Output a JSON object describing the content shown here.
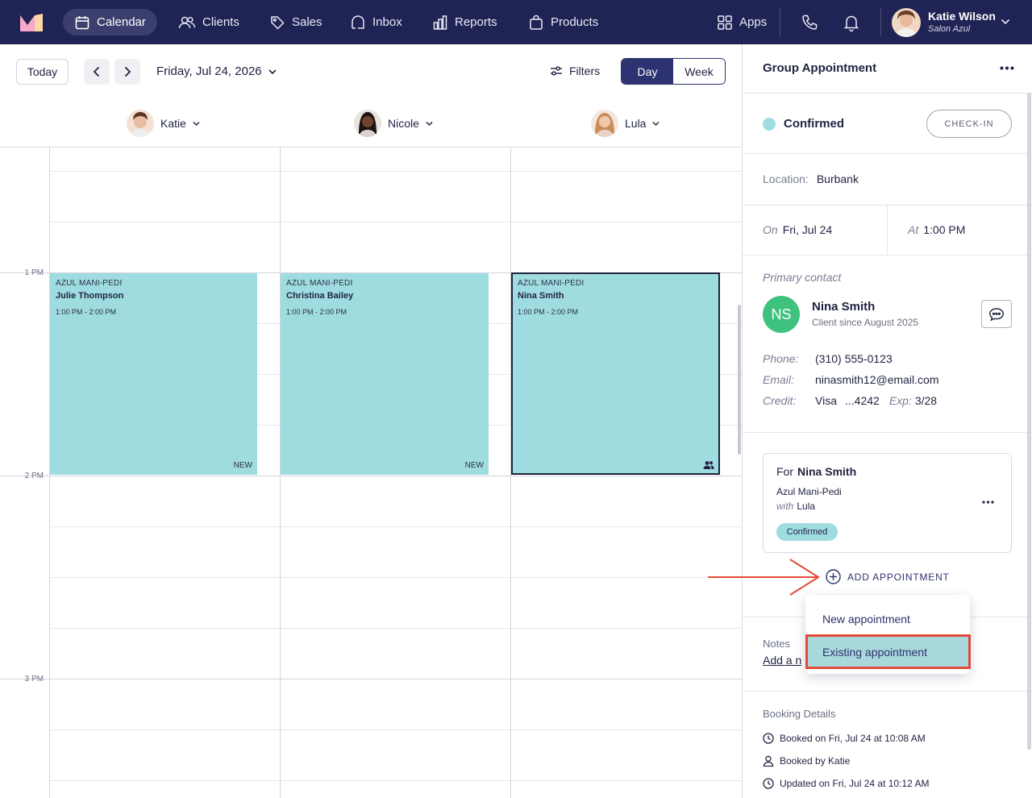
{
  "nav": {
    "items": [
      {
        "label": "Calendar",
        "icon": "calendar-icon",
        "active": true
      },
      {
        "label": "Clients",
        "icon": "clients-icon",
        "active": false
      },
      {
        "label": "Sales",
        "icon": "tag-icon",
        "active": false
      },
      {
        "label": "Inbox",
        "icon": "inbox-icon",
        "active": false
      },
      {
        "label": "Reports",
        "icon": "reports-icon",
        "active": false
      },
      {
        "label": "Products",
        "icon": "bag-icon",
        "active": false
      }
    ],
    "apps_label": "Apps",
    "user": {
      "name": "Katie Wilson",
      "salon": "Salon Azul"
    }
  },
  "toolbar": {
    "today_label": "Today",
    "date_label": "Friday, Jul 24, 2026",
    "filters_label": "Filters",
    "view_day": "Day",
    "view_week": "Week",
    "active_view": "Day"
  },
  "staff": [
    {
      "name": "Katie"
    },
    {
      "name": "Nicole"
    },
    {
      "name": "Lula"
    }
  ],
  "times": {
    "one": "1 PM",
    "two": "2 PM",
    "three": "3 PM"
  },
  "events": [
    {
      "type": "AZUL MANI-PEDI",
      "client": "Julie Thompson",
      "time": "1:00 PM - 2:00 PM",
      "tag": "NEW"
    },
    {
      "type": "AZUL MANI-PEDI",
      "client": "Christina Bailey",
      "time": "1:00 PM - 2:00 PM",
      "tag": "NEW"
    },
    {
      "type": "AZUL MANI-PEDI",
      "client": "Nina Smith",
      "time": "1:00 PM - 2:00 PM",
      "tag": "group-icon"
    }
  ],
  "panel": {
    "title": "Group Appointment",
    "status": "Confirmed",
    "status_color": "#9fdcdf",
    "checkin_label": "CHECK-IN",
    "location_label": "Location:",
    "location": "Burbank",
    "on_label": "On",
    "on_value": "Fri, Jul 24",
    "at_label": "At",
    "at_value": "1:00 PM",
    "primary_contact_label": "Primary contact",
    "contact": {
      "initials": "NS",
      "name": "Nina Smith",
      "since": "Client since August 2025",
      "phone_label": "Phone:",
      "phone": "(310) 555-0123",
      "email_label": "Email:",
      "email": "ninasmith12@email.com",
      "credit_label": "Credit:",
      "credit_brand": "Visa",
      "credit_last4": "...4242",
      "exp_label": "Exp:",
      "exp": "3/28"
    },
    "card": {
      "for_label": "For",
      "for_name": "Nina Smith",
      "service": "Azul Mani-Pedi",
      "with_label": "with",
      "with_name": "Lula",
      "badge": "Confirmed"
    },
    "add_appointment_label": "ADD APPOINTMENT",
    "dropdown": {
      "new_label": "New appointment",
      "existing_label": "Existing appointment"
    },
    "notes_label": "Notes",
    "notes_add": "Add a n",
    "booking_label": "Booking Details",
    "booked_on": "Booked on Fri, Jul 24 at 10:08 AM",
    "booked_by": "Booked by Katie",
    "updated_on": "Updated on Fri, Jul 24 at 10:12 AM"
  },
  "colors": {
    "nav_bg": "#1f2454",
    "event_bg": "#9fdcdf",
    "avatar_green": "#3fc27e",
    "highlight_red": "#e24b3a"
  }
}
